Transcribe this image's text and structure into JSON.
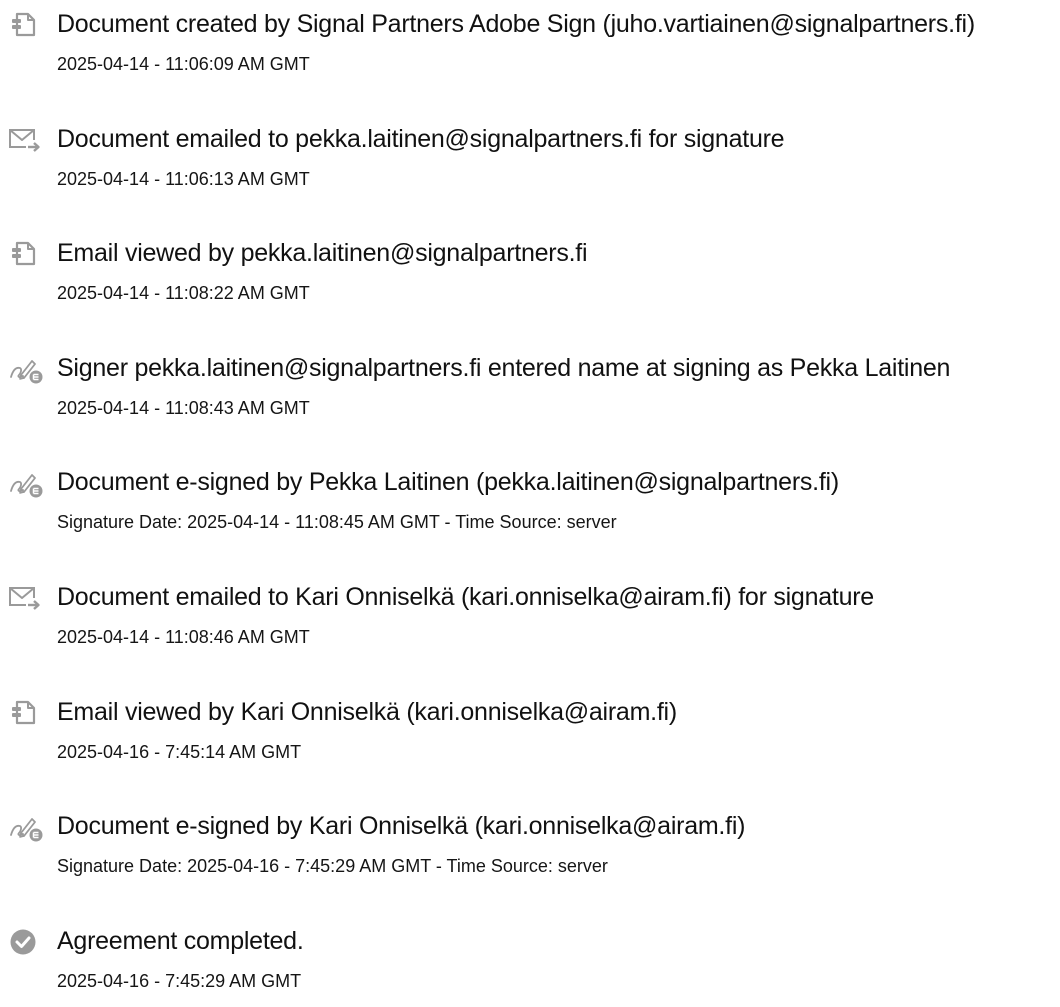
{
  "events": [
    {
      "icon": "document-icon",
      "title": "Document created by Signal Partners Adobe Sign (juho.vartiainen@signalpartners.fi)",
      "meta": "2025-04-14 - 11:06:09 AM GMT"
    },
    {
      "icon": "email-sent-icon",
      "title": "Document emailed to pekka.laitinen@signalpartners.fi for signature",
      "meta": "2025-04-14 - 11:06:13 AM GMT"
    },
    {
      "icon": "document-icon",
      "title": "Email viewed by pekka.laitinen@signalpartners.fi",
      "meta": "2025-04-14 - 11:08:22 AM GMT"
    },
    {
      "icon": "esign-pen-icon",
      "title": "Signer pekka.laitinen@signalpartners.fi entered name at signing as Pekka Laitinen",
      "meta": "2025-04-14 - 11:08:43 AM GMT"
    },
    {
      "icon": "esign-pen-icon",
      "title": "Document e-signed by Pekka Laitinen (pekka.laitinen@signalpartners.fi)",
      "meta": "Signature Date: 2025-04-14 - 11:08:45 AM GMT - Time Source: server"
    },
    {
      "icon": "email-sent-icon",
      "title": "Document emailed to Kari Onniselkä (kari.onniselka@airam.fi) for signature",
      "meta": "2025-04-14 - 11:08:46 AM GMT"
    },
    {
      "icon": "document-icon",
      "title": "Email viewed by Kari Onniselkä (kari.onniselka@airam.fi)",
      "meta": "2025-04-16 - 7:45:14 AM GMT"
    },
    {
      "icon": "esign-pen-icon",
      "title": "Document e-signed by Kari Onniselkä (kari.onniselka@airam.fi)",
      "meta": "Signature Date: 2025-04-16 - 7:45:29 AM GMT - Time Source: server"
    },
    {
      "icon": "check-circle-icon",
      "title": "Agreement completed.",
      "meta": "2025-04-16 - 7:45:29 AM GMT"
    }
  ],
  "colors": {
    "icon": "#9a9a9a",
    "text": "#111111"
  }
}
